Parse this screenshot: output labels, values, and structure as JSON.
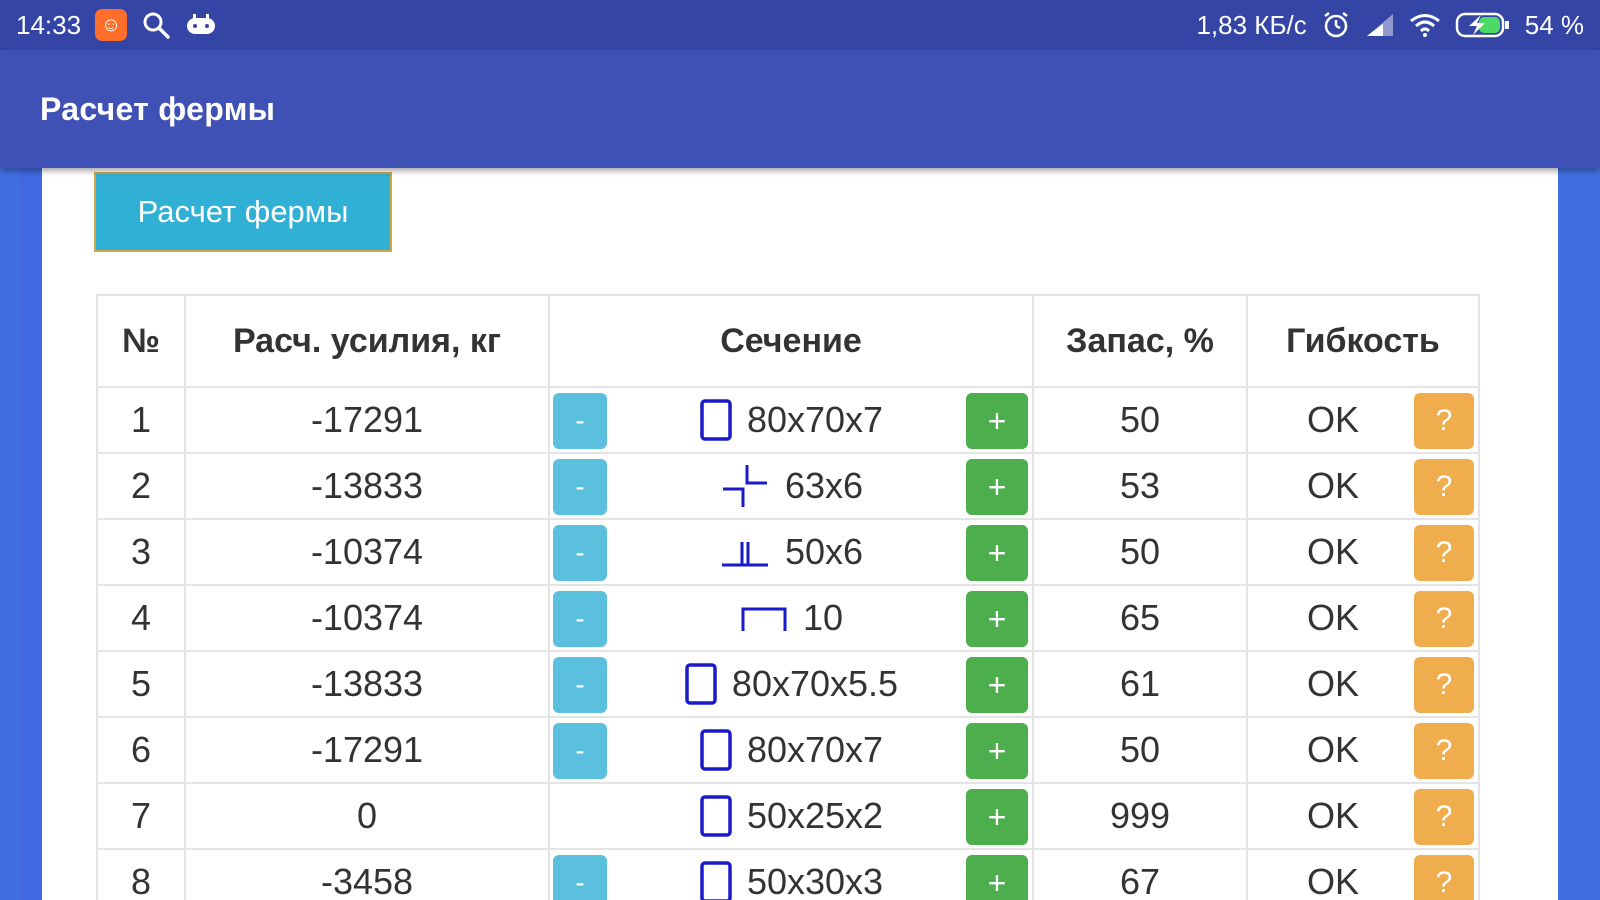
{
  "status_bar": {
    "time": "14:33",
    "speed": "1,83 КБ/с",
    "battery": "54 %",
    "icons": [
      "app-notification-icon",
      "search-icon",
      "game-icon",
      "alarm-icon",
      "signal-icon",
      "wifi-icon",
      "battery-charging-icon"
    ]
  },
  "app_bar": {
    "title": "Расчет фермы"
  },
  "calc_button": {
    "label": "Расчет фермы"
  },
  "table": {
    "headers": [
      "№",
      "Расч. усилия, кг",
      "Сечение",
      "Запас, %",
      "Гибкость"
    ],
    "minus_label": "-",
    "plus_label": "+",
    "help_label": "?",
    "rows": [
      {
        "n": "1",
        "force": "-17291",
        "section": "80x70x7",
        "profile_icon": "rect-tube-icon",
        "has_minus": true,
        "reserve": "50",
        "flex": "OK"
      },
      {
        "n": "2",
        "force": "-13833",
        "section": "63x6",
        "profile_icon": "double-angle-cross-icon",
        "has_minus": true,
        "reserve": "53",
        "flex": "OK"
      },
      {
        "n": "3",
        "force": "-10374",
        "section": "50x6",
        "profile_icon": "double-angle-t-icon",
        "has_minus": true,
        "reserve": "50",
        "flex": "OK"
      },
      {
        "n": "4",
        "force": "-10374",
        "section": "10",
        "profile_icon": "channel-icon",
        "has_minus": true,
        "reserve": "65",
        "flex": "OK"
      },
      {
        "n": "5",
        "force": "-13833",
        "section": "80x70x5.5",
        "profile_icon": "rect-tube-icon",
        "has_minus": true,
        "reserve": "61",
        "flex": "OK"
      },
      {
        "n": "6",
        "force": "-17291",
        "section": "80x70x7",
        "profile_icon": "rect-tube-icon",
        "has_minus": true,
        "reserve": "50",
        "flex": "OK"
      },
      {
        "n": "7",
        "force": "0",
        "section": "50x25x2",
        "profile_icon": "rect-tube-icon",
        "has_minus": false,
        "reserve": "999",
        "flex": "OK"
      },
      {
        "n": "8",
        "force": "-3458",
        "section": "50x30x3",
        "profile_icon": "rect-tube-icon",
        "has_minus": true,
        "reserve": "67",
        "flex": "OK"
      }
    ]
  }
}
